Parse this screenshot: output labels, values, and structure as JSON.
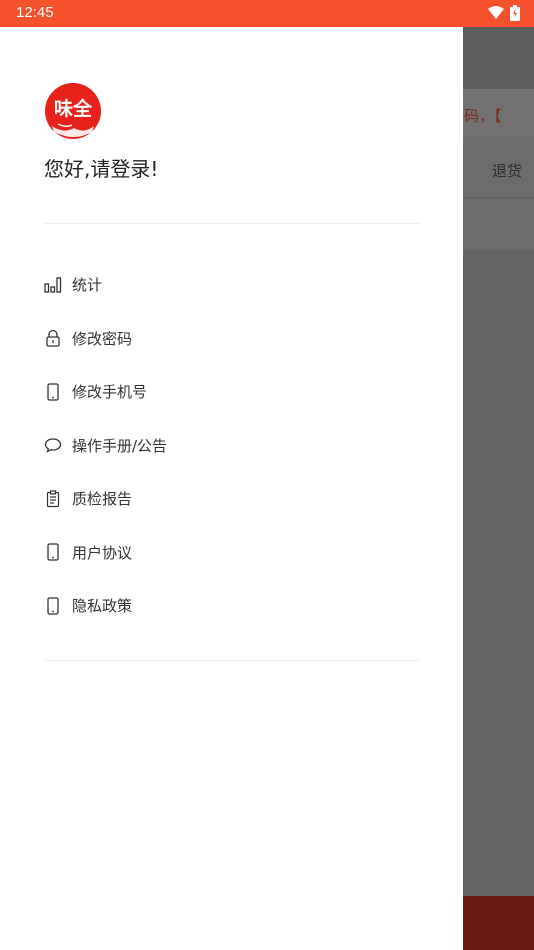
{
  "status_bar": {
    "time": "12:45",
    "background": "#f4512c"
  },
  "background_app": {
    "marquee_text": "条码，【",
    "row_label": "退货"
  },
  "drawer": {
    "logo_text": "味全",
    "greeting": "您好,请登录!",
    "menu": [
      {
        "label": "统计",
        "icon": "bar-chart-icon"
      },
      {
        "label": "修改密码",
        "icon": "lock-icon"
      },
      {
        "label": "修改手机号",
        "icon": "phone-icon"
      },
      {
        "label": "操作手册/公告",
        "icon": "chat-bubble-icon"
      },
      {
        "label": "质检报告",
        "icon": "clipboard-icon"
      },
      {
        "label": "用户协议",
        "icon": "phone-icon"
      },
      {
        "label": "隐私政策",
        "icon": "phone-icon"
      }
    ]
  },
  "colors": {
    "accent": "#f4512c",
    "brand_red": "#e8221b"
  }
}
